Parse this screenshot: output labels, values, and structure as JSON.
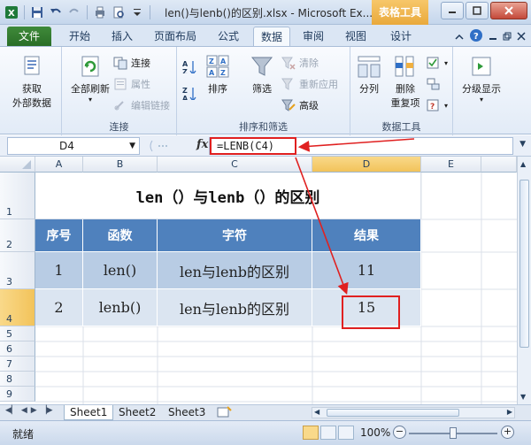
{
  "window": {
    "title": "len()与lenb()的区别.xlsx - Microsoft Ex...",
    "context_tab": "表格工具"
  },
  "tabs": [
    {
      "label": "文件"
    },
    {
      "label": "开始"
    },
    {
      "label": "插入"
    },
    {
      "label": "页面布局"
    },
    {
      "label": "公式"
    },
    {
      "label": "数据"
    },
    {
      "label": "审阅"
    },
    {
      "label": "视图"
    },
    {
      "label": "设计"
    }
  ],
  "ribbon": {
    "get_external": {
      "label": "获取\n外部数据",
      "line1": "获取",
      "line2": "外部数据"
    },
    "connections_group": {
      "refresh_all": "全部刷新",
      "connections": "连接",
      "properties": "属性",
      "edit_links": "编辑链接",
      "label": "连接"
    },
    "sort_group": {
      "sort": "排序",
      "filter": "筛选",
      "clear": "清除",
      "reapply": "重新应用",
      "advanced": "高级",
      "label": "排序和筛选"
    },
    "data_tools_group": {
      "text_to_columns": "分列",
      "remove_duplicates_1": "删除",
      "remove_duplicates_2": "重复项",
      "label": "数据工具"
    },
    "outline": {
      "label": "分级显示"
    }
  },
  "formula_bar": {
    "name_box": "D4",
    "fx": "fx",
    "formula": "=LENB(C4)"
  },
  "grid": {
    "columns": [
      "A",
      "B",
      "C",
      "D",
      "E"
    ],
    "rows": [
      "1",
      "2",
      "3",
      "4",
      "5",
      "6",
      "7",
      "8",
      "9"
    ],
    "title": "len（）与lenb（）的区别",
    "headers": [
      "序号",
      "函数",
      "字符",
      "结果"
    ],
    "data": [
      [
        "1",
        "len()",
        "len与lenb的区别",
        "11"
      ],
      [
        "2",
        "lenb()",
        "len与lenb的区别",
        "15"
      ]
    ]
  },
  "sheets": [
    {
      "label": "Sheet1"
    },
    {
      "label": "Sheet2"
    },
    {
      "label": "Sheet3"
    }
  ],
  "status": {
    "ready": "就绪",
    "zoom": "100%"
  },
  "colors": {
    "header_blue": "#4f81bd",
    "row_band_1": "#b8cce4",
    "row_band_2": "#dbe5f1",
    "annotation_red": "#e02020",
    "file_tab_green": "#2a6e27"
  }
}
